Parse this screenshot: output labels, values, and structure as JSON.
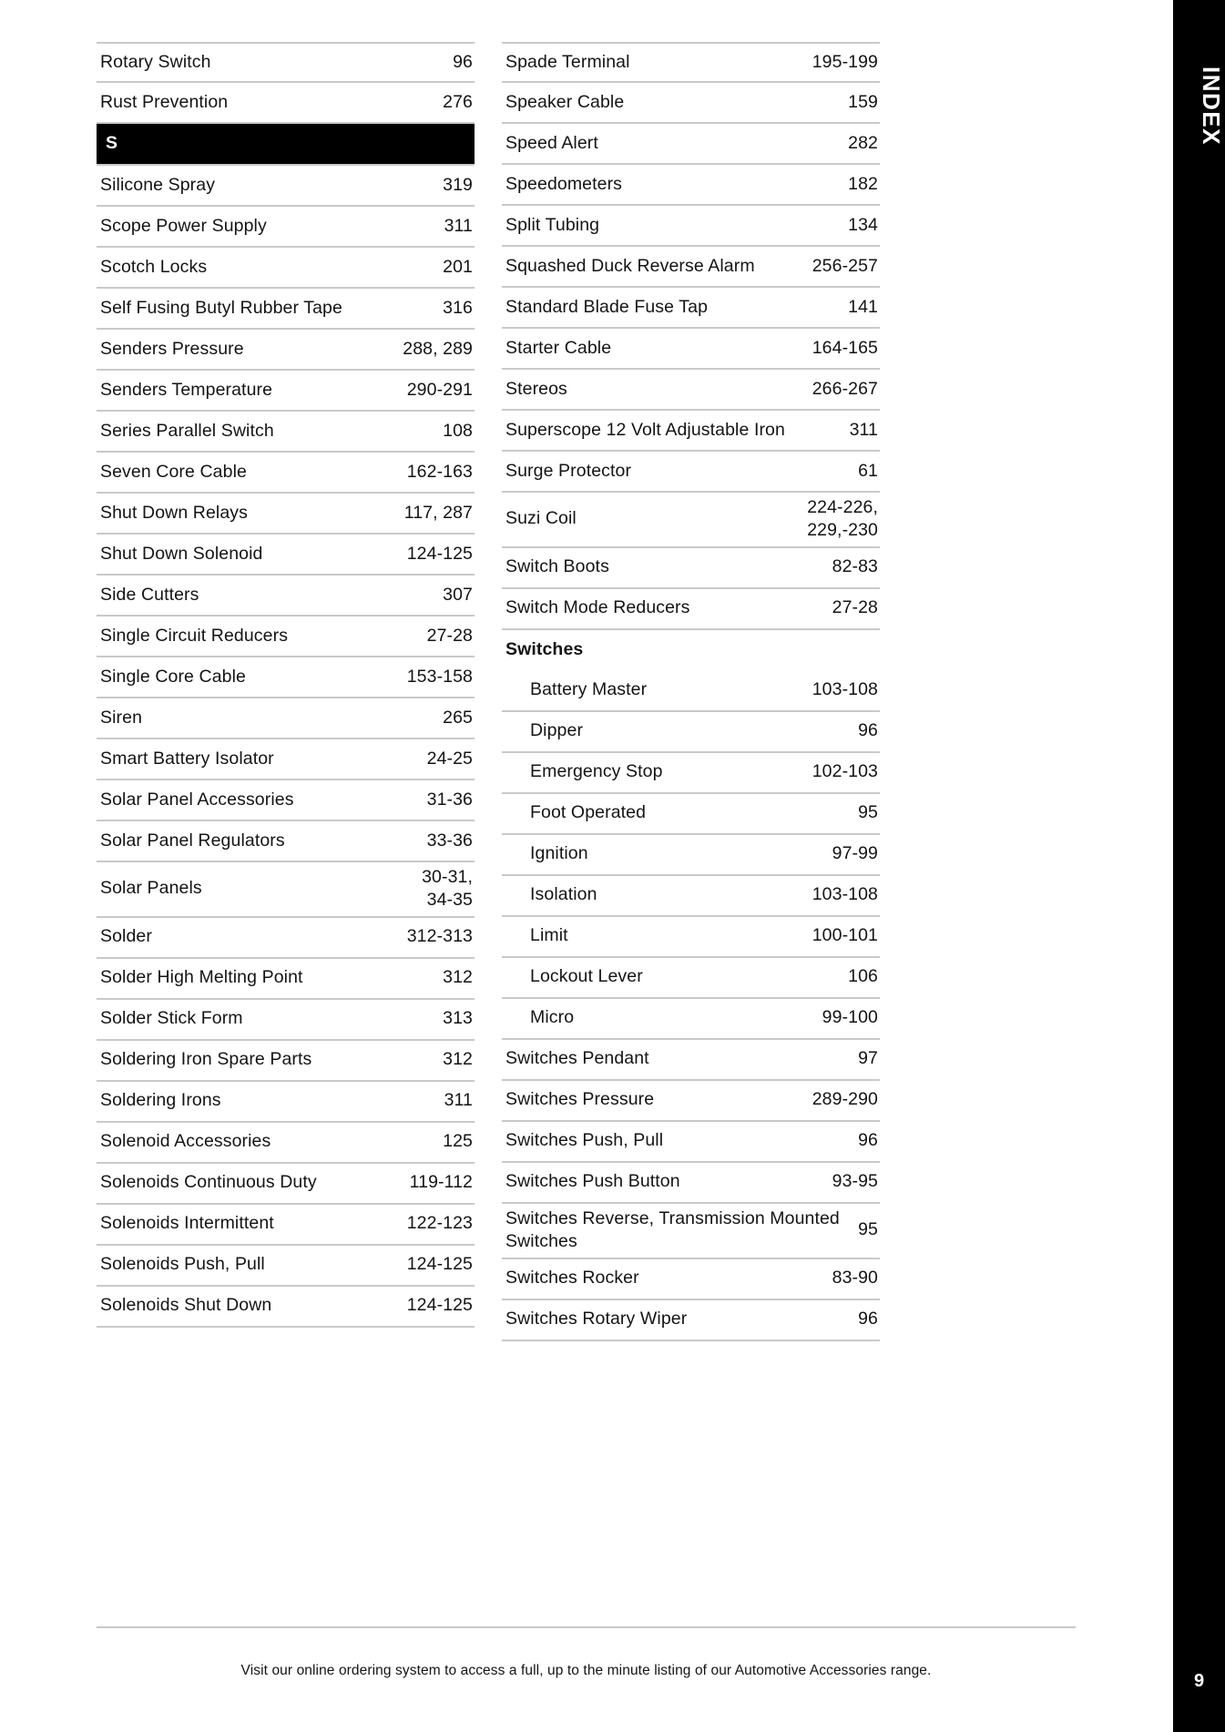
{
  "tab": {
    "label": "INDEX",
    "page_number": "9",
    "background_color": "#000000",
    "text_color": "#ffffff"
  },
  "footer": {
    "note": "Visit our online ordering system to access a full, up to the minute listing of our Automotive Accessories range."
  },
  "colors": {
    "rule": "#c9c9c9",
    "text": "#141414",
    "letter_band_bg": "#000000",
    "letter_band_text": "#ffffff"
  },
  "left_column": [
    {
      "entry": "Rotary Switch",
      "pages": "96",
      "type": "item"
    },
    {
      "entry": "Rust Prevention",
      "pages": "276",
      "type": "item"
    },
    {
      "entry": "S",
      "pages": "",
      "type": "letter"
    },
    {
      "entry": "Silicone Spray",
      "pages": "319",
      "type": "item"
    },
    {
      "entry": "Scope Power Supply",
      "pages": "311",
      "type": "item"
    },
    {
      "entry": "Scotch Locks",
      "pages": "201",
      "type": "item"
    },
    {
      "entry": "Self Fusing Butyl Rubber Tape",
      "pages": "316",
      "type": "item"
    },
    {
      "entry": "Senders Pressure",
      "pages": "288, 289",
      "type": "item"
    },
    {
      "entry": "Senders Temperature",
      "pages": "290-291",
      "type": "item"
    },
    {
      "entry": "Series Parallel Switch",
      "pages": "108",
      "type": "item"
    },
    {
      "entry": "Seven Core Cable",
      "pages": "162-163",
      "type": "item"
    },
    {
      "entry": "Shut Down Relays",
      "pages": "117, 287",
      "type": "item"
    },
    {
      "entry": "Shut Down Solenoid",
      "pages": "124-125",
      "type": "item"
    },
    {
      "entry": "Side Cutters",
      "pages": "307",
      "type": "item"
    },
    {
      "entry": "Single Circuit Reducers",
      "pages": "27-28",
      "type": "item"
    },
    {
      "entry": "Single Core Cable",
      "pages": "153-158",
      "type": "item"
    },
    {
      "entry": "Siren",
      "pages": "265",
      "type": "item"
    },
    {
      "entry": "Smart Battery Isolator",
      "pages": "24-25",
      "type": "item"
    },
    {
      "entry": "Solar Panel Accessories",
      "pages": "31-36",
      "type": "item"
    },
    {
      "entry": "Solar Panel Regulators",
      "pages": "33-36",
      "type": "item"
    },
    {
      "entry": "Solar Panels",
      "pages": "30-31,\n34-35",
      "type": "tall"
    },
    {
      "entry": "Solder",
      "pages": "312-313",
      "type": "item"
    },
    {
      "entry": "Solder High Melting Point",
      "pages": "312",
      "type": "item"
    },
    {
      "entry": "Solder Stick Form",
      "pages": "313",
      "type": "item"
    },
    {
      "entry": "Soldering Iron Spare Parts",
      "pages": "312",
      "type": "item"
    },
    {
      "entry": "Soldering Irons",
      "pages": "311",
      "type": "item"
    },
    {
      "entry": "Solenoid Accessories",
      "pages": "125",
      "type": "item"
    },
    {
      "entry": "Solenoids Continuous Duty",
      "pages": "119-112",
      "type": "item"
    },
    {
      "entry": "Solenoids Intermittent",
      "pages": "122-123",
      "type": "item"
    },
    {
      "entry": "Solenoids Push, Pull",
      "pages": "124-125",
      "type": "item"
    },
    {
      "entry": "Solenoids Shut Down",
      "pages": "124-125",
      "type": "item"
    }
  ],
  "right_column": [
    {
      "entry": "Spade Terminal",
      "pages": "195-199",
      "type": "item"
    },
    {
      "entry": "Speaker Cable",
      "pages": "159",
      "type": "item"
    },
    {
      "entry": "Speed Alert",
      "pages": "282",
      "type": "item"
    },
    {
      "entry": "Speedometers",
      "pages": "182",
      "type": "item"
    },
    {
      "entry": "Split Tubing",
      "pages": "134",
      "type": "item"
    },
    {
      "entry": "Squashed Duck Reverse Alarm",
      "pages": "256-257",
      "type": "item"
    },
    {
      "entry": "Standard Blade Fuse Tap",
      "pages": "141",
      "type": "item"
    },
    {
      "entry": "Starter Cable",
      "pages": "164-165",
      "type": "item"
    },
    {
      "entry": "Stereos",
      "pages": "266-267",
      "type": "item"
    },
    {
      "entry": "Superscope 12 Volt Adjustable Iron",
      "pages": "311",
      "type": "item"
    },
    {
      "entry": "Surge Protector",
      "pages": "61",
      "type": "item"
    },
    {
      "entry": "Suzi Coil",
      "pages": "224-226,\n229,-230",
      "type": "tall"
    },
    {
      "entry": "Switch Boots",
      "pages": "82-83",
      "type": "item"
    },
    {
      "entry": "Switch Mode Reducers",
      "pages": "27-28",
      "type": "item"
    },
    {
      "entry": "Switches",
      "pages": "",
      "type": "group"
    },
    {
      "entry": "Battery Master",
      "pages": "103-108",
      "type": "sub"
    },
    {
      "entry": "Dipper",
      "pages": "96",
      "type": "sub"
    },
    {
      "entry": "Emergency Stop",
      "pages": "102-103",
      "type": "sub"
    },
    {
      "entry": "Foot Operated",
      "pages": "95",
      "type": "sub"
    },
    {
      "entry": "Ignition",
      "pages": "97-99",
      "type": "sub"
    },
    {
      "entry": "Isolation",
      "pages": "103-108",
      "type": "sub"
    },
    {
      "entry": "Limit",
      "pages": "100-101",
      "type": "sub"
    },
    {
      "entry": "Lockout Lever",
      "pages": "106",
      "type": "sub"
    },
    {
      "entry": "Micro",
      "pages": "99-100",
      "type": "sub"
    },
    {
      "entry": "Switches Pendant",
      "pages": "97",
      "type": "item"
    },
    {
      "entry": "Switches Pressure",
      "pages": "289-290",
      "type": "item"
    },
    {
      "entry": "Switches Push, Pull",
      "pages": "96",
      "type": "item"
    },
    {
      "entry": "Switches Push Button",
      "pages": "93-95",
      "type": "item"
    },
    {
      "entry": "Switches Reverse, Transmission Mounted Switches",
      "pages": "95",
      "type": "tall"
    },
    {
      "entry": "Switches Rocker",
      "pages": "83-90",
      "type": "item"
    },
    {
      "entry": "Switches Rotary Wiper",
      "pages": "96",
      "type": "item"
    }
  ]
}
